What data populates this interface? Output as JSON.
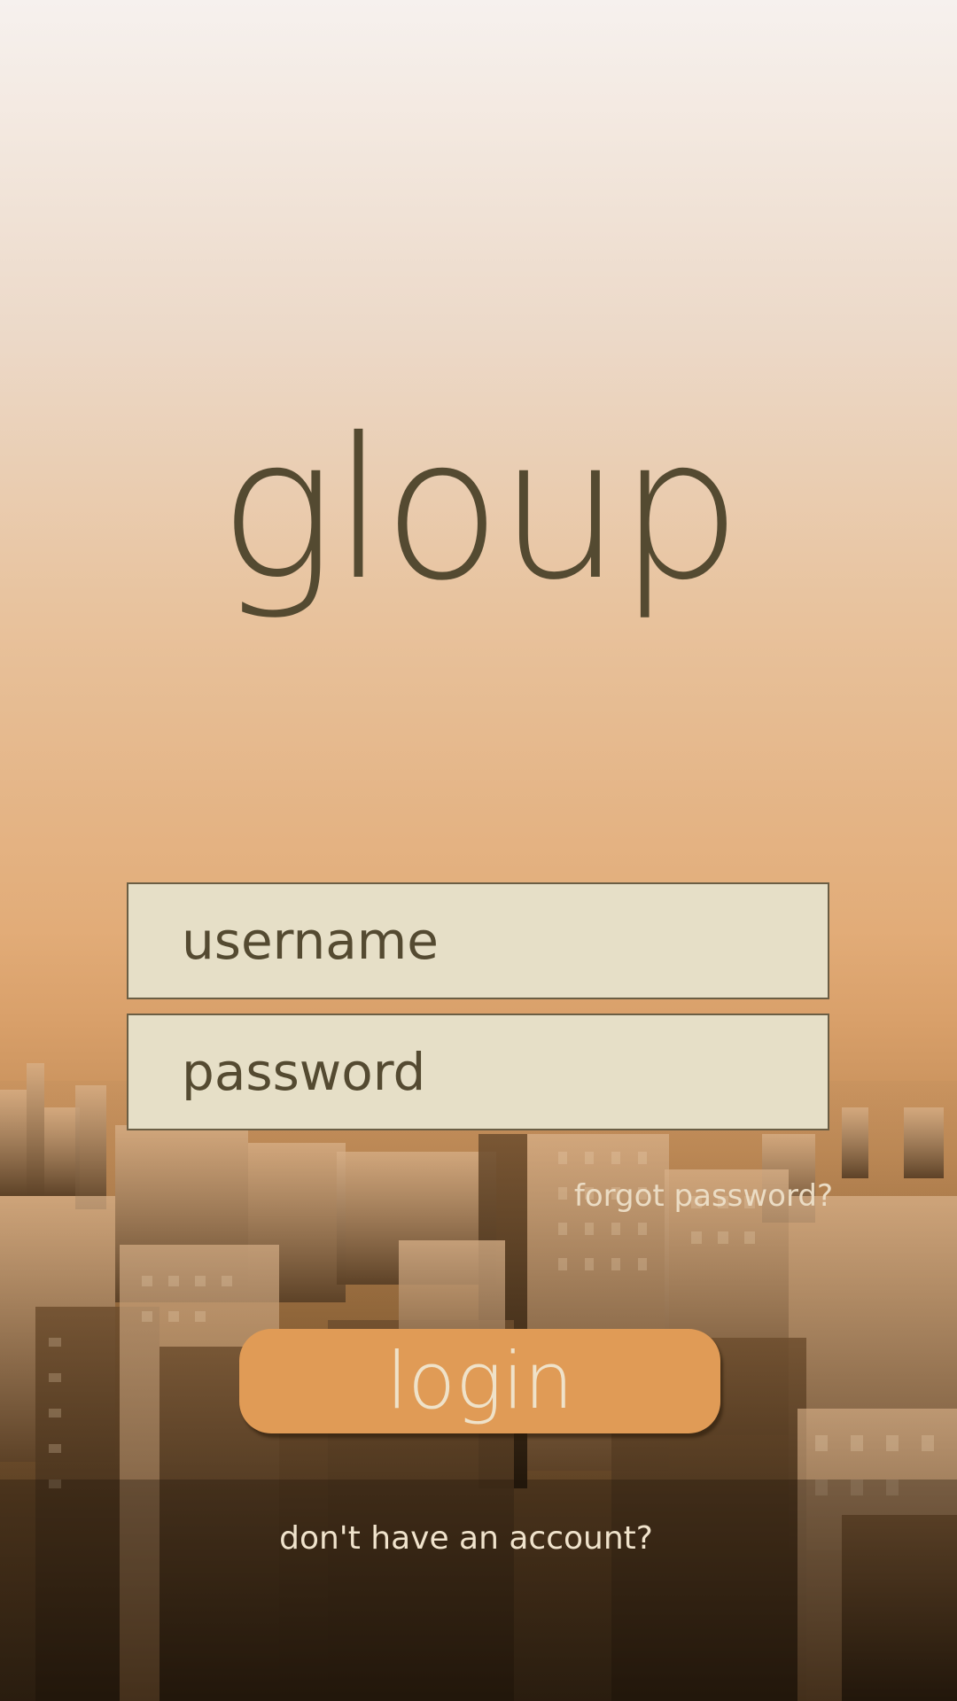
{
  "app": {
    "logo_text": "gloup"
  },
  "login_form": {
    "username_placeholder": "username",
    "password_placeholder": "password",
    "forgot_password_label": "forgot password?",
    "login_button_label": "login",
    "signup_prompt": "don't have an account?"
  },
  "colors": {
    "logo_text": "#544a31",
    "field_background": "#e6dfc7",
    "field_border": "#6b5e44",
    "button_background": "#e09b56",
    "button_text": "#efe2c9",
    "background_top": "#f6f1ee",
    "background_mid": "#e2ac78",
    "background_bottom": "#2f2112"
  },
  "background": {
    "image": "city-skyline"
  }
}
